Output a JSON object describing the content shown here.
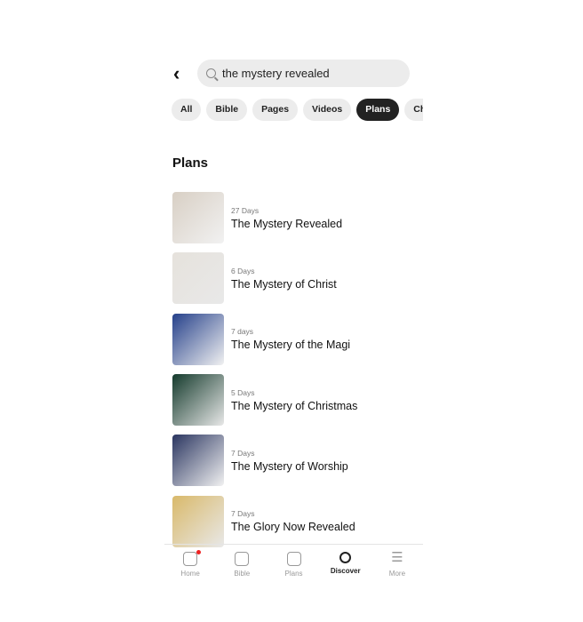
{
  "search": {
    "query": "the mystery revealed"
  },
  "filters": [
    {
      "label": "All"
    },
    {
      "label": "Bible"
    },
    {
      "label": "Pages"
    },
    {
      "label": "Videos"
    },
    {
      "label": "Plans",
      "active": true
    },
    {
      "label": "Churches"
    }
  ],
  "section_title": "Plans",
  "plans": [
    {
      "days": "27 Days",
      "title": "The Mystery Revealed",
      "color": "#d8cfc4"
    },
    {
      "days": "6 Days",
      "title": "The Mystery of Christ",
      "color": "#e6e2dc"
    },
    {
      "days": "7 days",
      "title": "The Mystery of the Magi",
      "color": "#25408a"
    },
    {
      "days": "5 Days",
      "title": "The Mystery of Christmas",
      "color": "#143a2c"
    },
    {
      "days": "7 Days",
      "title": "The Mystery of Worship",
      "color": "#2a3560"
    },
    {
      "days": "7 Days",
      "title": "The Glory Now Revealed",
      "color": "#d9b96a"
    }
  ],
  "nav": [
    {
      "label": "Home",
      "badge": true
    },
    {
      "label": "Bible"
    },
    {
      "label": "Plans"
    },
    {
      "label": "Discover",
      "active": true
    },
    {
      "label": "More"
    }
  ]
}
